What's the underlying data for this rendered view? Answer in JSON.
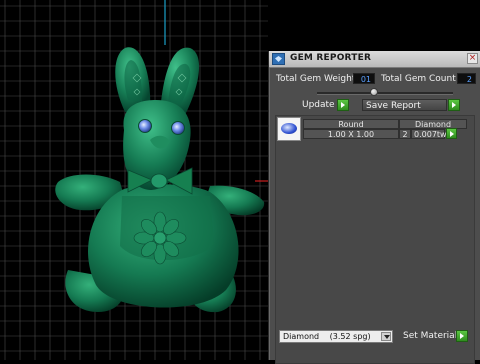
{
  "viewport": {
    "name": "3D viewport",
    "colors": {
      "background": "#000000",
      "grid": "#4a4a4a",
      "axis_y": "#1aa0c8",
      "axis_x": "#c81e1e",
      "model": "#1b7a55"
    }
  },
  "panel": {
    "title": "GEM REPORTER",
    "icons": {
      "app": "gem-icon",
      "close": "close-icon"
    },
    "total_weight_label": "Total Gem Weight",
    "total_weight_value": "01",
    "total_count_label": "Total Gem Count",
    "total_count_value": "2",
    "update_label": "Update",
    "save_report_label": "Save Report",
    "table": {
      "headers": [
        "Round",
        "Diamond"
      ],
      "rows": [
        {
          "size": "1.00 X 1.00",
          "count": "2",
          "weight": "0.007tw"
        }
      ]
    },
    "material": {
      "selected": "Diamond",
      "spg": "(3.52 spg)"
    },
    "set_material_label": "Set Material",
    "accent_green": "#3ea82a"
  }
}
